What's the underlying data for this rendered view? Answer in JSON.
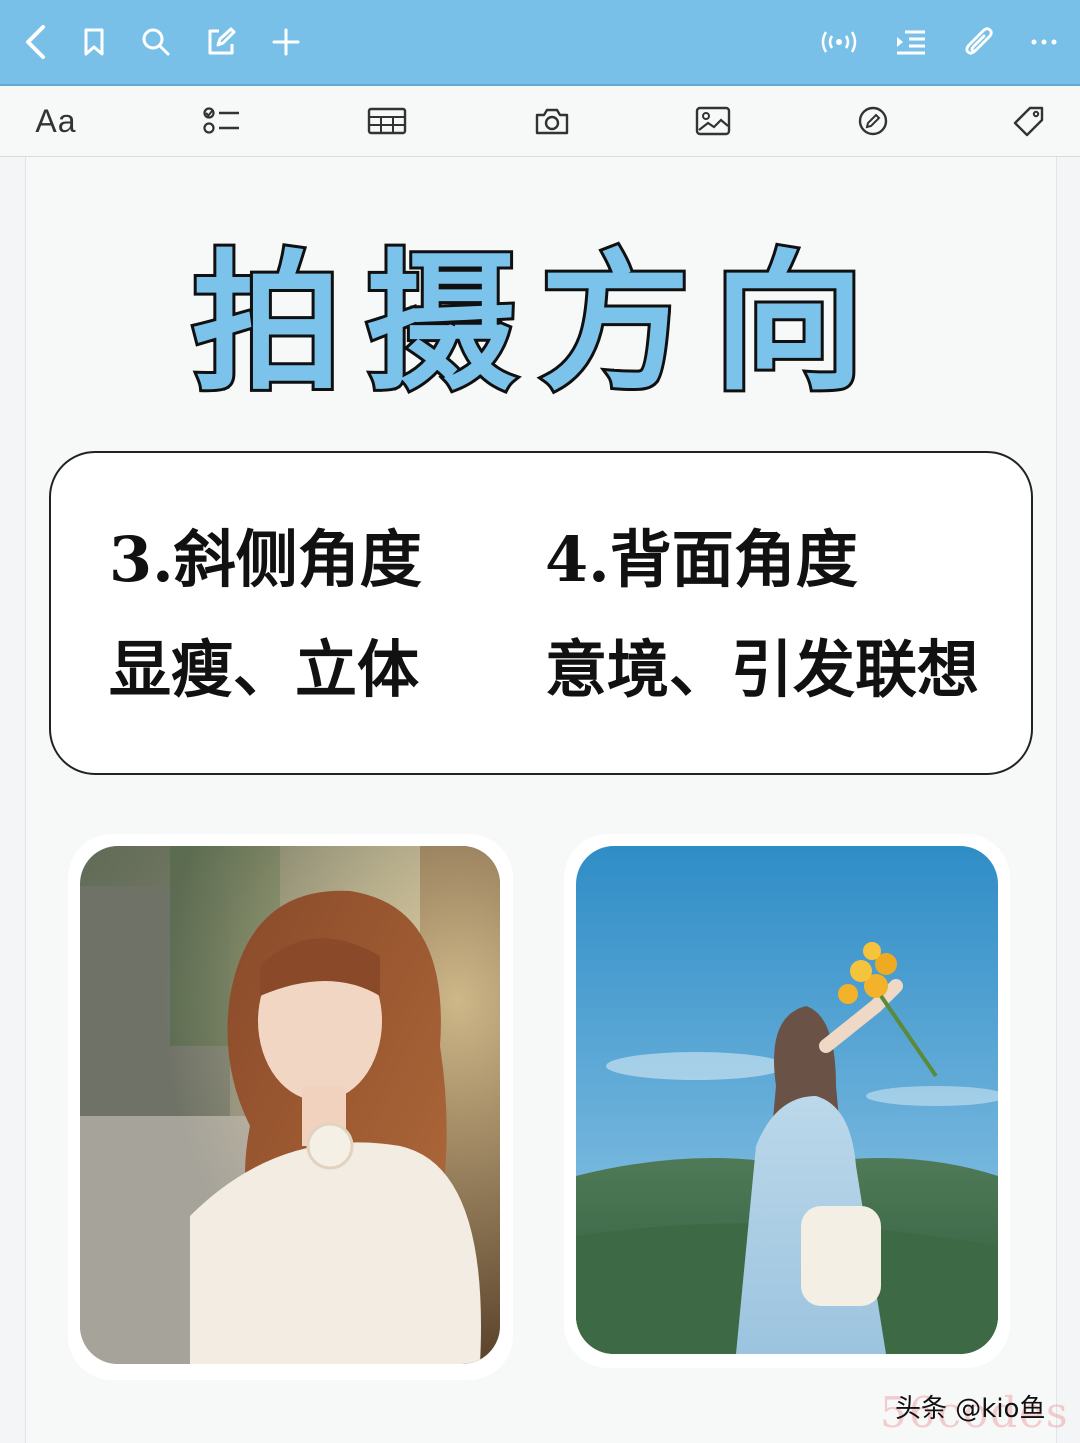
{
  "topbar": {
    "left_icons": [
      "back-icon",
      "bookmark-icon",
      "search-icon",
      "edit-icon",
      "plus-icon"
    ],
    "right_icons": [
      "broadcast-icon",
      "list-indent-icon",
      "attachment-icon",
      "more-icon"
    ]
  },
  "toolbar": {
    "font_label": "Aa",
    "icons": [
      "checklist-icon",
      "table-icon",
      "camera-icon",
      "image-icon",
      "pen-icon",
      "tag-icon"
    ]
  },
  "colors": {
    "accent": "#79c0e9",
    "title_fill": "#7cc3ec",
    "title_stroke": "#101010"
  },
  "content": {
    "title": "拍摄方向",
    "card": {
      "left": {
        "heading": "3.斜侧角度",
        "sub": "显瘦、立体"
      },
      "right": {
        "heading": "4.背面角度",
        "sub": "意境、引发联想"
      }
    },
    "photos": [
      {
        "subject": "girl-side-angle-photo"
      },
      {
        "subject": "girl-back-view-flowers-photo"
      }
    ]
  },
  "watermark": {
    "text": "头条 @kio鱼",
    "overlay": "56codes"
  }
}
